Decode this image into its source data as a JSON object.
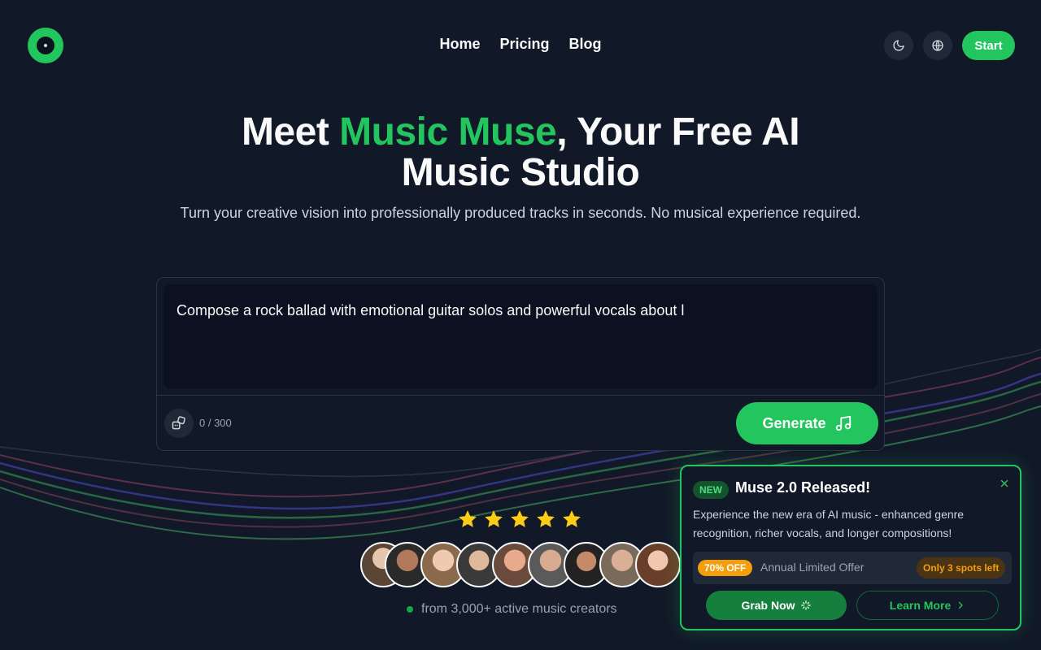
{
  "header": {
    "nav": [
      "Home",
      "Pricing",
      "Blog"
    ],
    "start_label": "Start"
  },
  "hero": {
    "title_part1": "Meet ",
    "title_accent": "Music Muse",
    "title_part2": ", Your Free AI",
    "title_line2": "Music Studio",
    "subtitle": "Turn your creative vision into professionally produced tracks in seconds. No musical experience required."
  },
  "prompt": {
    "value": "Compose a rock ballad with emotional guitar solos and powerful vocals about l",
    "counter": "0 / 300",
    "generate_label": "Generate"
  },
  "social": {
    "rating_stars": 5,
    "creators_text": "from 3,000+ active music creators"
  },
  "popup": {
    "badge": "NEW",
    "title": "Muse 2.0 Released!",
    "text": "Experience the new era of AI music - enhanced genre recognition, richer vocals, and longer compositions!",
    "off_badge": "70% OFF",
    "offer_text": "Annual Limited Offer",
    "spots": "Only 3 spots left",
    "grab_label": "Grab Now",
    "learn_label": "Learn More"
  },
  "colors": {
    "accent": "#22c55e",
    "background": "#111827",
    "star": "#facc15",
    "offer": "#f59e0b"
  }
}
